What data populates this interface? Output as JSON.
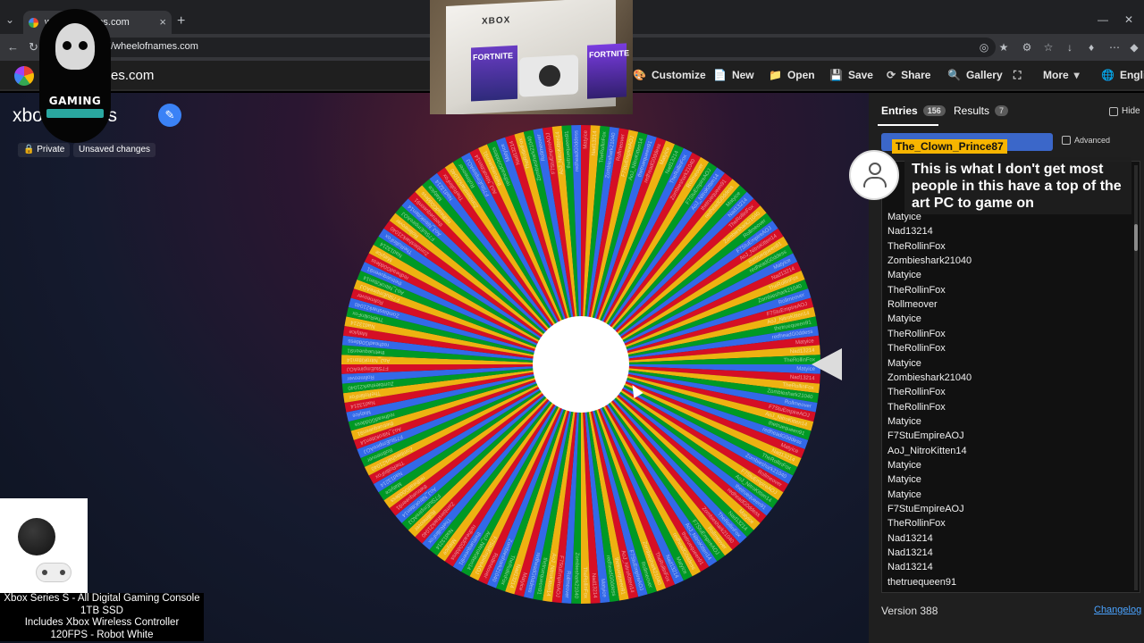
{
  "browser": {
    "tab_title": "wheelofnames.com",
    "url": "://wheelofnames.com",
    "new_tab": "+",
    "close_tab": "×"
  },
  "app": {
    "site_name": "es.com",
    "menu": [
      {
        "label": "Customize",
        "icon": "palette-icon",
        "glyph": "🎨"
      },
      {
        "label": "New",
        "icon": "new-file-icon",
        "glyph": "📄"
      },
      {
        "label": "Open",
        "icon": "folder-icon",
        "glyph": "📁"
      },
      {
        "label": "Save",
        "icon": "save-icon",
        "glyph": "💾"
      },
      {
        "label": "Share",
        "icon": "share-icon",
        "glyph": "⟳"
      },
      {
        "label": "Gallery",
        "icon": "search-icon",
        "glyph": "🔍"
      },
      {
        "label": "",
        "icon": "fullscreen-icon",
        "glyph": "⛶"
      },
      {
        "label": "More",
        "icon": "chevron-down-icon",
        "glyph": "▾"
      },
      {
        "label": "Englis",
        "icon": "globe-icon",
        "glyph": "🌐"
      }
    ]
  },
  "wheel": {
    "title": "xbo",
    "title_suffix": "ucks",
    "private_label": "Private",
    "unsaved_label": "Unsaved changes",
    "segment_colors": [
      "#3369e8",
      "#d50f25",
      "#eeb211",
      "#009925"
    ],
    "segment_count": 156,
    "labels": [
      "Matyice",
      "Nad13214",
      "TheRollinFox",
      "Zombieshark21040",
      "Rollmeover",
      "F7StuEmpireAOJ",
      "AoJ_NitroKitten14",
      "thetruequeen91",
      "redheadG0ddess"
    ]
  },
  "panel": {
    "entries_tab": "Entries",
    "entries_count": "156",
    "results_tab": "Results",
    "results_count": "7",
    "hide_label": "Hide",
    "advanced_label": "Advanced",
    "entries": [
      "Matyice",
      "Nad13214",
      "TheRollinFox",
      "Zombieshark21040",
      "Matyice",
      "TheRollinFox",
      "Rollmeover",
      "Matyice",
      "TheRollinFox",
      "TheRollinFox",
      "Matyice",
      "Zombieshark21040",
      "TheRollinFox",
      "TheRollinFox",
      "Matyice",
      "F7StuEmpireAOJ",
      "AoJ_NitroKitten14",
      "Matyice",
      "Matyice",
      "Matyice",
      "F7StuEmpireAOJ",
      "TheRollinFox",
      "Nad13214",
      "Nad13214",
      "Nad13214",
      "thetruequeen91"
    ],
    "version": "Version 388",
    "changelog": "Changelog"
  },
  "chat": {
    "username": "The_Clown_Prince87",
    "message": "This is what I don't get most people in this have a top of the art PC to game on"
  },
  "overlays": {
    "gaming_logo_text": "GAMING",
    "box_brand": "XBOX",
    "box_art_text": "FORTNITE"
  },
  "product": {
    "lines": [
      "Xbox Series S - All Digital Gaming Console",
      "1TB SSD",
      "Includes Xbox Wireless Controller",
      "120FPS - Robot White"
    ]
  }
}
